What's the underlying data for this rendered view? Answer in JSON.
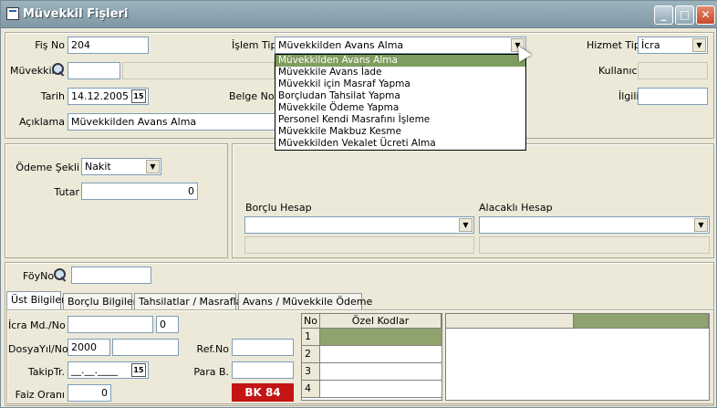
{
  "window": {
    "title": "Müvekkil Fişleri"
  },
  "titlebar_buttons": {
    "minimize": "_",
    "maximize": "□",
    "close": "✕"
  },
  "header": {
    "fis_no_label": "Fiş No",
    "fis_no_value": "204",
    "islem_tipi_label": "İşlem Tipi",
    "islem_tipi_value": "Müvekkilden Avans Alma",
    "hizmet_tipi_label": "Hizmet Tipi",
    "hizmet_tipi_value": "İcra",
    "muvekkil_label": "Müvekkil",
    "muvekkil_code": "",
    "kullanici_label": "Kullanıcı",
    "tarih_label": "Tarih",
    "tarih_value": "14.12.2005",
    "belge_no_label": "Belge No",
    "ilgili_label": "İlgili",
    "aciklama_label": "Açıklama",
    "aciklama_value": "Müvekkilden Avans Alma"
  },
  "islem_tipi_options": [
    "Müvekkilden Avans Alma",
    "Müvekkile Avans İade",
    "Müvekkil için Masraf Yapma",
    "Borçludan Tahsilat Yapma",
    "Müvekkile Ödeme Yapma",
    "Personel Kendi Masrafını İşleme",
    "Müvekkile Makbuz Kesme",
    "Müvekkilden Vekalet Ücreti Alma"
  ],
  "payment": {
    "odeme_sekli_label": "Ödeme Şekli",
    "odeme_sekli_value": "Nakit",
    "tutar_label": "Tutar",
    "tutar_value": "0",
    "borclu_hesap_label": "Borçlu Hesap",
    "alacakli_hesap_label": "Alacaklı Hesap"
  },
  "foy": {
    "foy_no_label": "FöyNo"
  },
  "tabs": [
    {
      "label": "Üst Bilgiler"
    },
    {
      "label": "Borçlu Bilgileri"
    },
    {
      "label": "Tahsilatlar / Masraflar"
    },
    {
      "label": "Avans / Müvekkile Ödeme"
    }
  ],
  "ust_bilgiler": {
    "icra_md_label": "İcra Md./No",
    "icra_md_no": "0",
    "dosya_yil_label": "DosyaYıl/No",
    "dosya_yil_value": "2000",
    "takip_tr_label": "TakipTr.",
    "takip_tr_value": "__.__.____",
    "faiz_orani_label": "Faiz Oranı",
    "faiz_orani_value": "0",
    "ref_no_label": "Ref.No",
    "para_b_label": "Para B.",
    "badge": "BK 84"
  },
  "codes_grid": {
    "col_no": "No",
    "col_ozel": "Özel Kodlar",
    "rows": [
      "1",
      "2",
      "3",
      "4"
    ]
  },
  "icons": {
    "calendar": "15"
  }
}
